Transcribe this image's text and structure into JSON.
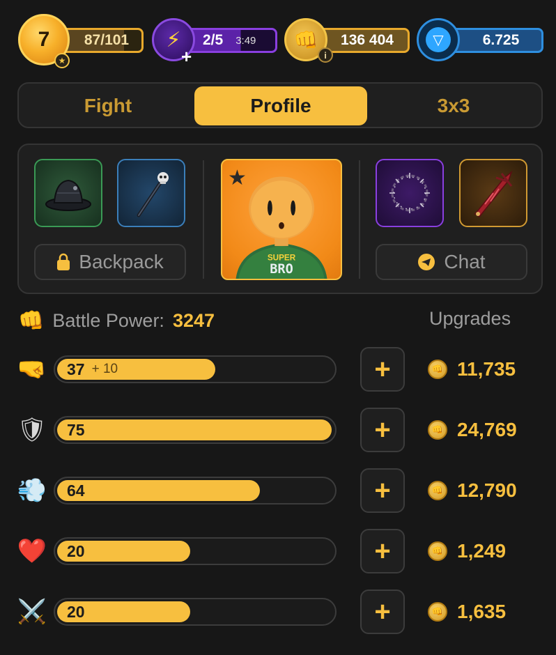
{
  "top": {
    "level": "7",
    "xp": "87/101",
    "energy": "2/5",
    "energy_timer": "3:49",
    "coins": "136 404",
    "ton": "6.725",
    "icons": {
      "level_star": "star-icon",
      "energy": "lightning-icon",
      "coin": "fist-coin-icon",
      "info": "info-icon",
      "ton": "ton-icon"
    }
  },
  "tabs": [
    {
      "label": "Fight",
      "active": false
    },
    {
      "label": "Profile",
      "active": true
    },
    {
      "label": "3x3",
      "active": false
    }
  ],
  "profile": {
    "slots": [
      "bucket-hat",
      "skull-staff",
      "barbed-ring",
      "crimson-blade"
    ],
    "backpack_label": "Backpack",
    "chat_label": "Chat",
    "avatar_shirt_line1": "SUPER",
    "avatar_shirt_line2": "BRO"
  },
  "battle_power": {
    "label": "Battle Power:",
    "value": "3247"
  },
  "upgrades_title": "Upgrades",
  "stats": [
    {
      "icon": "punch-icon",
      "glyph": "🤜",
      "value": "37",
      "bonus": "+ 10",
      "cost": "11,735",
      "fill": 0.57
    },
    {
      "icon": "shield-icon",
      "glyph": "🛡",
      "value": "75",
      "bonus": "",
      "cost": "24,769",
      "fill": 1.0
    },
    {
      "icon": "dash-icon",
      "glyph": "💨",
      "value": "64",
      "bonus": "",
      "cost": "12,790",
      "fill": 0.73
    },
    {
      "icon": "heart-icon",
      "glyph": "❤️",
      "value": "20",
      "bonus": "",
      "cost": "1,249",
      "fill": 0.48
    },
    {
      "icon": "crossed-swords-icon",
      "glyph": "⚔️",
      "value": "20",
      "bonus": "",
      "cost": "1,635",
      "fill": 0.48
    }
  ],
  "colors": {
    "accent": "#f7bf3f",
    "background": "#171717",
    "panel": "#1f1f1f"
  }
}
